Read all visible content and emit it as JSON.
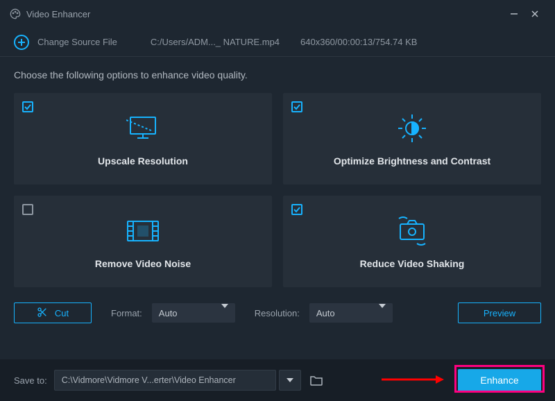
{
  "titlebar": {
    "title": "Video Enhancer"
  },
  "source": {
    "change_label": "Change Source File",
    "path": "C:/Users/ADM..._ NATURE.mp4",
    "meta": "640x360/00:00:13/754.74 KB"
  },
  "instruction": "Choose the following options to enhance video quality.",
  "cards": [
    {
      "label": "Upscale Resolution",
      "checked": true
    },
    {
      "label": "Optimize Brightness and Contrast",
      "checked": true
    },
    {
      "label": "Remove Video Noise",
      "checked": false
    },
    {
      "label": "Reduce Video Shaking",
      "checked": true
    }
  ],
  "controls": {
    "cut_label": "Cut",
    "format_label": "Format:",
    "format_value": "Auto",
    "resolution_label": "Resolution:",
    "resolution_value": "Auto",
    "preview_label": "Preview"
  },
  "footer": {
    "save_label": "Save to:",
    "path": "C:\\Vidmore\\Vidmore V...erter\\Video Enhancer",
    "enhance_label": "Enhance"
  },
  "colors": {
    "accent": "#17b3ff",
    "primary_btn": "#17a8e8",
    "highlight": "#ff0080"
  }
}
